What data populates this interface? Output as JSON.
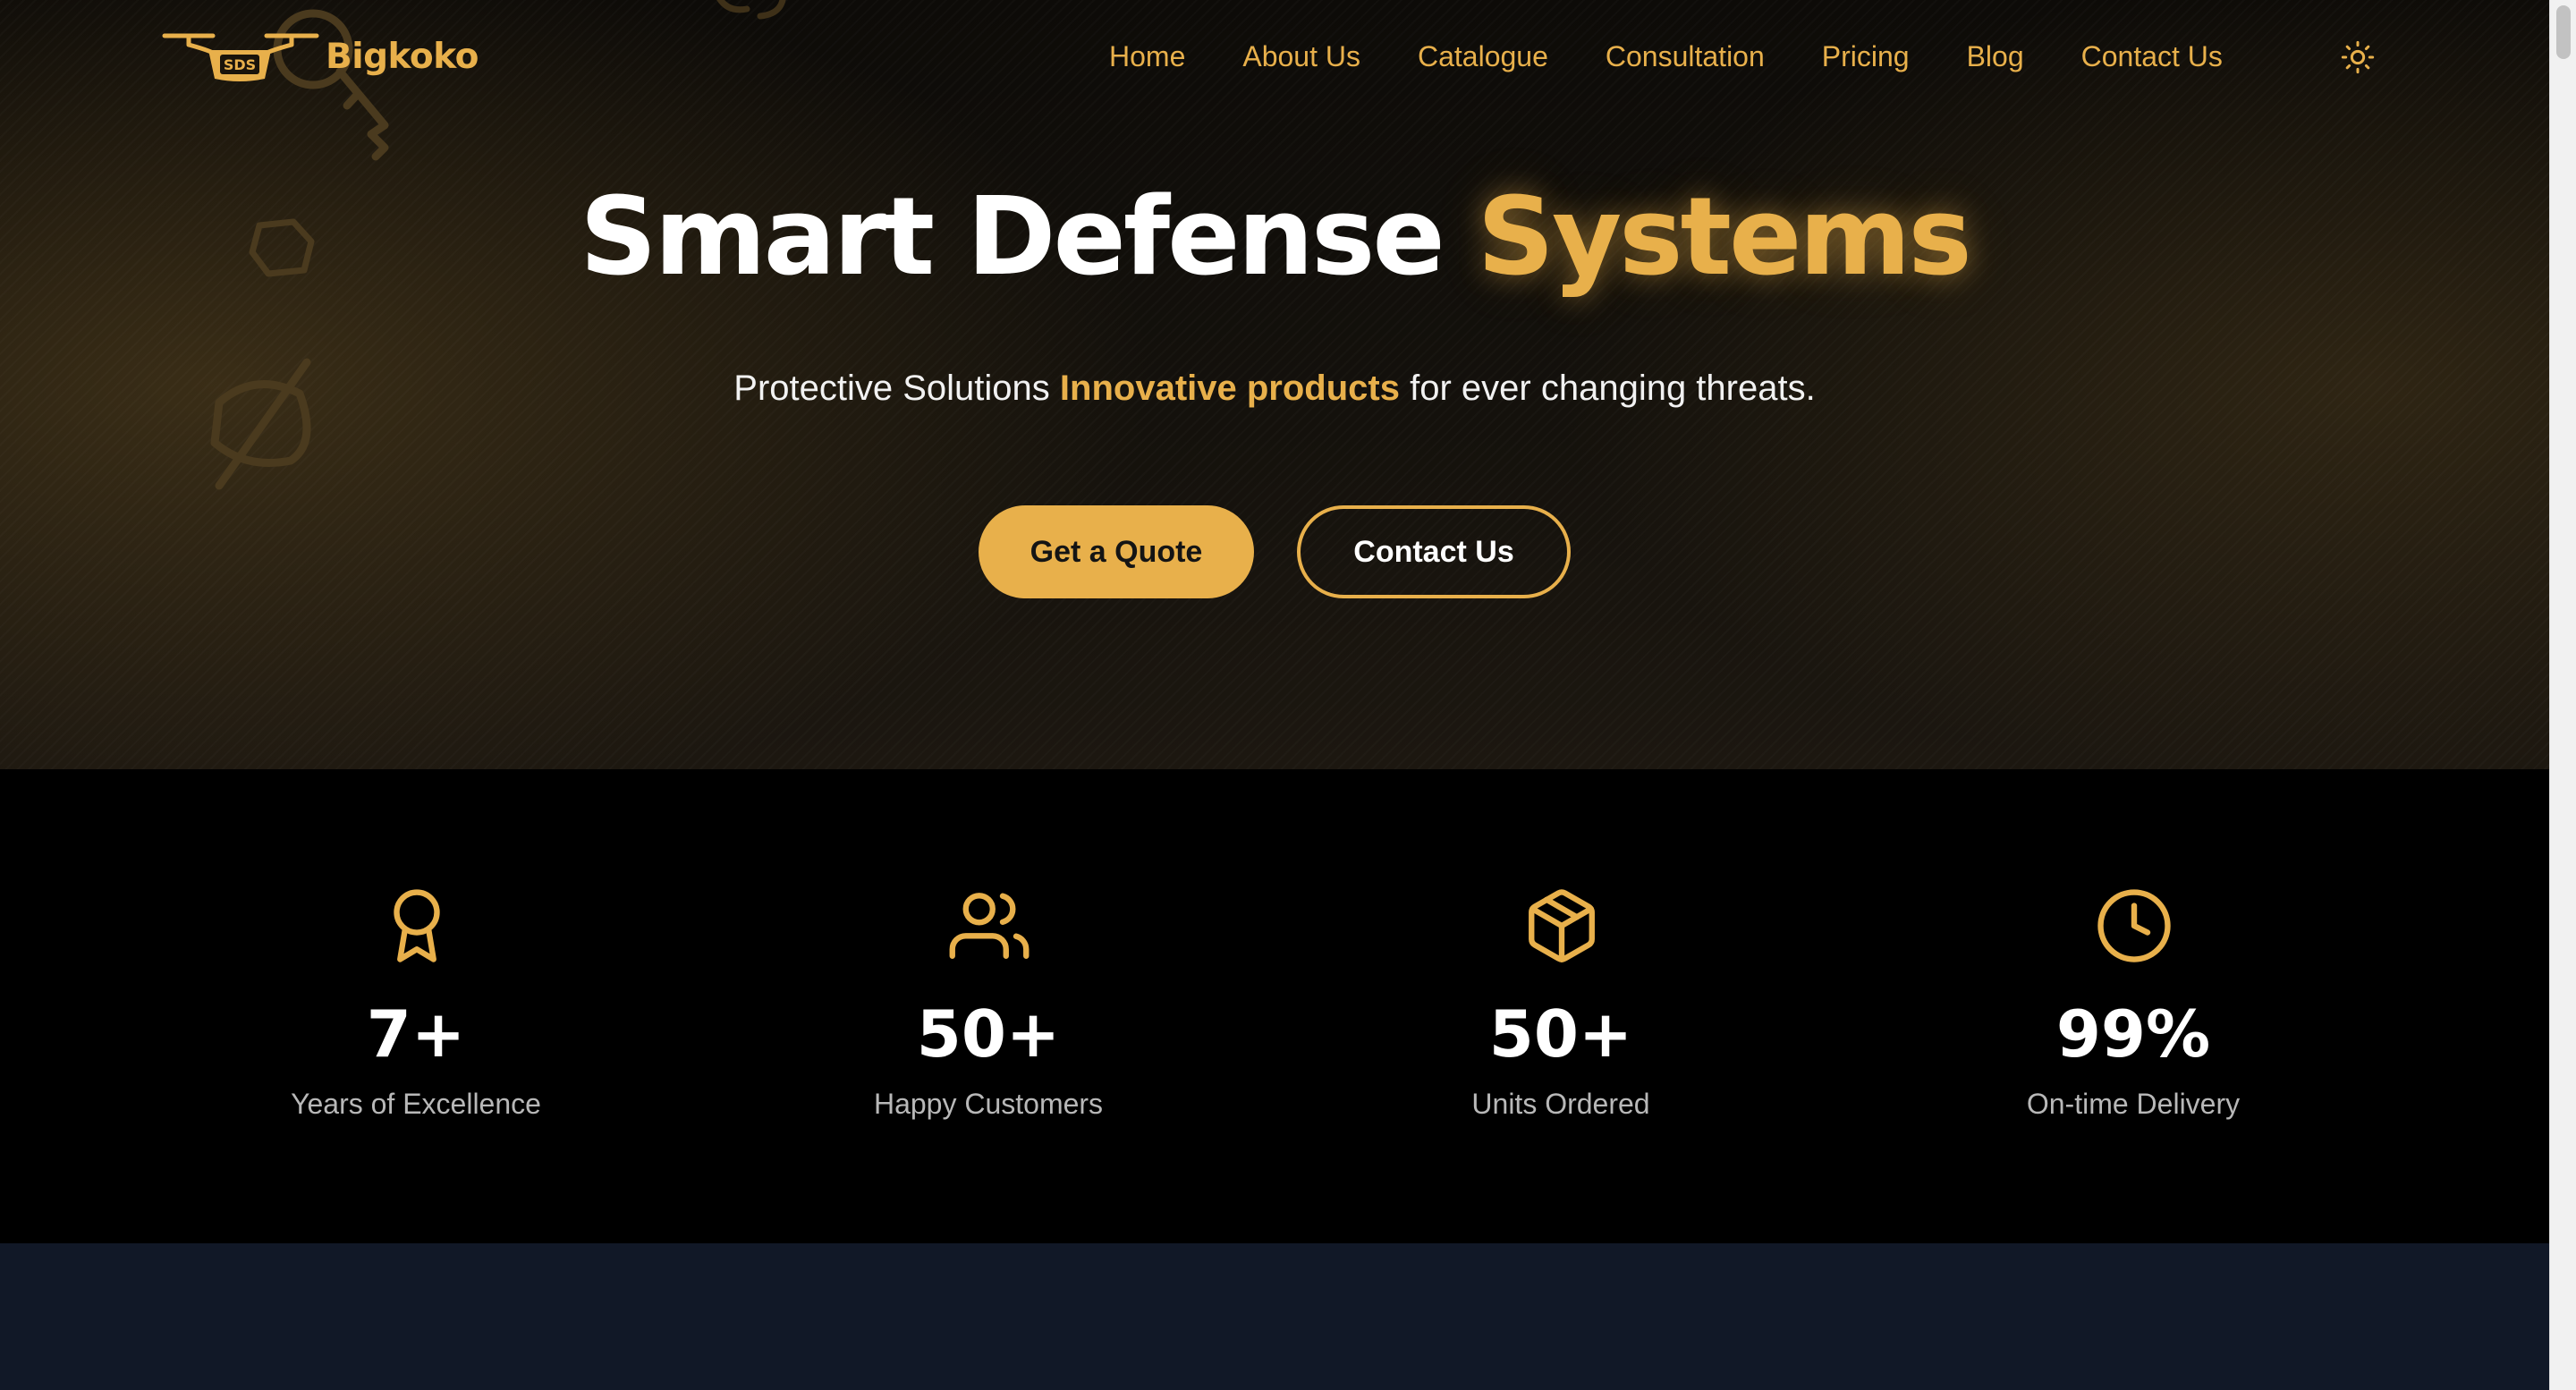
{
  "brand": {
    "badge": "SDS",
    "name": "Bigkoko",
    "accent_color": "#e8b04b"
  },
  "nav": {
    "items": [
      {
        "label": "Home"
      },
      {
        "label": "About Us"
      },
      {
        "label": "Catalogue"
      },
      {
        "label": "Consultation"
      },
      {
        "label": "Pricing"
      },
      {
        "label": "Blog"
      },
      {
        "label": "Contact Us"
      }
    ],
    "theme_toggle_icon": "sun-icon"
  },
  "hero": {
    "title_main": "Smart Defense",
    "title_accent": "Systems",
    "subtitle_lead": "Protective Solutions",
    "subtitle_accent": "Innovative products",
    "subtitle_tail": "for ever changing threats.",
    "primary_cta": "Get a Quote",
    "secondary_cta": "Contact Us"
  },
  "stats": [
    {
      "icon": "award-icon",
      "value": "7+",
      "label": "Years of Excellence"
    },
    {
      "icon": "users-icon",
      "value": "50+",
      "label": "Happy Customers"
    },
    {
      "icon": "box-icon",
      "value": "50+",
      "label": "Units Ordered"
    },
    {
      "icon": "clock-icon",
      "value": "99%",
      "label": "On-time Delivery"
    }
  ]
}
